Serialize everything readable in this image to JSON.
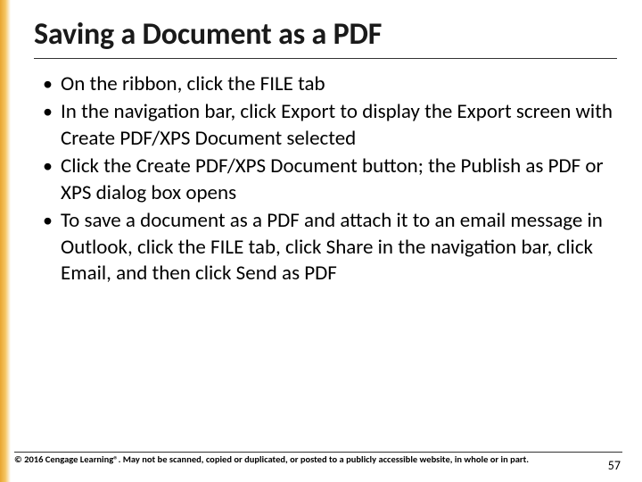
{
  "slide": {
    "title": "Saving a Document as a PDF",
    "bullets": [
      "On the ribbon, click the FILE tab",
      "In the navigation bar, click Export to display the Export screen with Create PDF/XPS Document selected",
      "Click the Create PDF/XPS Document button; the Publish as PDF or XPS dialog box opens",
      "To save a document as a PDF and attach it to an email message in Outlook, click the FILE tab, click Share in the navigation bar, click Email, and then click Send as PDF"
    ]
  },
  "footer": {
    "copyright": "© 2016 Cengage Learning®. May not be scanned, copied or duplicated, or posted to a publicly accessible website, in whole or in part.",
    "page_number": "57"
  },
  "colors": {
    "accent": "#e8a530"
  }
}
